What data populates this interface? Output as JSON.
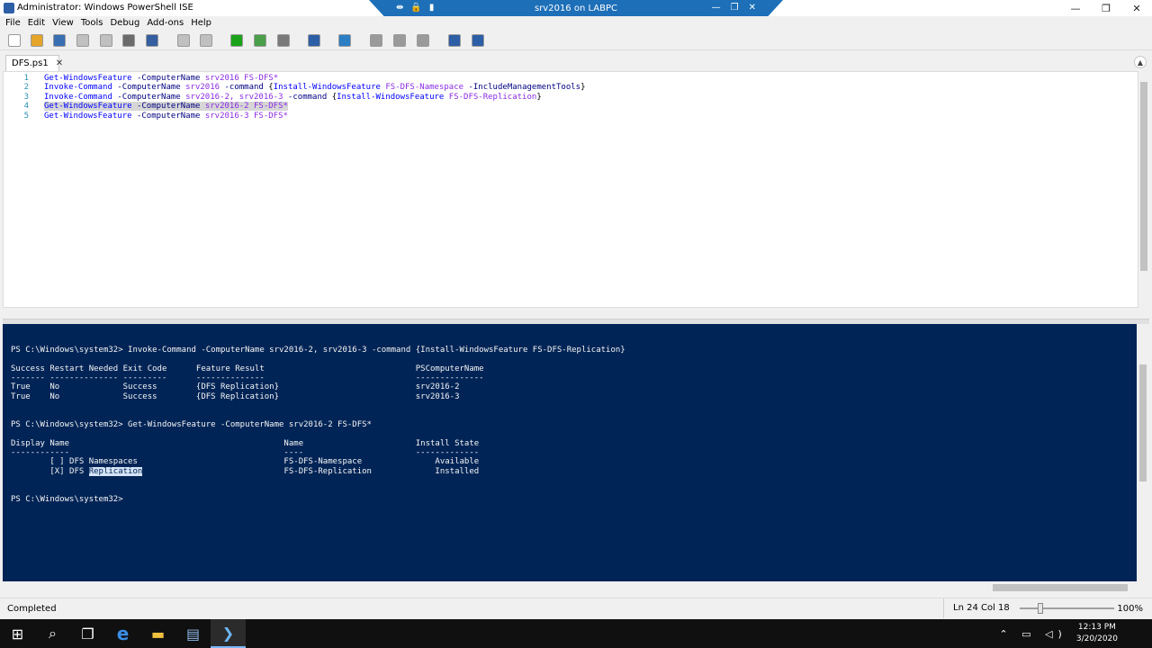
{
  "window": {
    "title": "Administrator: Windows PowerShell ISE",
    "controls": {
      "minimize": "—",
      "restore": "❐",
      "close": "✕"
    }
  },
  "remote_bar": {
    "title": "srv2016 on LABPC",
    "left_icons": [
      "⇹",
      "🔒",
      "▮"
    ],
    "controls": {
      "minimize": "—",
      "restore": "❐",
      "close": "✕"
    }
  },
  "menu": [
    "File",
    "Edit",
    "View",
    "Tools",
    "Debug",
    "Add-ons",
    "Help"
  ],
  "toolbar_icons": [
    {
      "name": "new-icon",
      "color": "#ffffff"
    },
    {
      "name": "open-icon",
      "color": "#e6a42b"
    },
    {
      "name": "save-icon",
      "color": "#3a6fb3"
    },
    {
      "name": "cut-icon",
      "color": "#c0c0c0"
    },
    {
      "name": "copy-icon",
      "color": "#c0c0c0"
    },
    {
      "name": "paste-icon",
      "color": "#6b6b6b"
    },
    {
      "name": "clear-console-icon",
      "color": "#355fa0"
    },
    {
      "name": "undo-icon",
      "color": "#c0c0c0"
    },
    {
      "name": "redo-icon",
      "color": "#c0c0c0"
    },
    {
      "name": "run-script-icon",
      "color": "#1aa31a"
    },
    {
      "name": "run-selection-icon",
      "color": "#4aa04a"
    },
    {
      "name": "stop-icon",
      "color": "#7a7a7a"
    },
    {
      "name": "new-remote-tab-icon",
      "color": "#2d5fa6"
    },
    {
      "name": "start-powershell-icon",
      "color": "#2d7fc4"
    },
    {
      "name": "show-script-top-icon",
      "color": "#9a9a9a"
    },
    {
      "name": "show-script-right-icon",
      "color": "#9a9a9a"
    },
    {
      "name": "show-script-maximized-icon",
      "color": "#9a9a9a"
    },
    {
      "name": "show-command-window-icon",
      "color": "#2d5fa6"
    },
    {
      "name": "show-command-addon-icon",
      "color": "#2d5fa6"
    }
  ],
  "tab": {
    "label": "DFS.ps1",
    "close": "✕"
  },
  "editor": {
    "lines": [
      {
        "num": "1",
        "tokens": [
          {
            "t": "Get-WindowsFeature",
            "c": "cmd"
          },
          {
            "t": " -ComputerName",
            "c": "param"
          },
          {
            "t": " srv2016",
            "c": "arg"
          },
          {
            "t": " FS-DFS*",
            "c": "arg"
          }
        ]
      },
      {
        "num": "2",
        "tokens": [
          {
            "t": "Invoke-Command",
            "c": "cmd"
          },
          {
            "t": " -ComputerName",
            "c": "param"
          },
          {
            "t": " srv2016",
            "c": "arg"
          },
          {
            "t": " -command",
            "c": "param"
          },
          {
            "t": " {",
            "c": "op"
          },
          {
            "t": "Install-WindowsFeature",
            "c": "cmd"
          },
          {
            "t": " FS-DFS-Namespace",
            "c": "arg"
          },
          {
            "t": " -IncludeManagementTools",
            "c": "param"
          },
          {
            "t": "}",
            "c": "op"
          }
        ]
      },
      {
        "num": "3",
        "tokens": [
          {
            "t": "Invoke-Command",
            "c": "cmd"
          },
          {
            "t": " -ComputerName",
            "c": "param"
          },
          {
            "t": " srv2016-2,",
            "c": "arg"
          },
          {
            "t": " srv2016-3",
            "c": "arg"
          },
          {
            "t": " -command",
            "c": "param"
          },
          {
            "t": " {",
            "c": "op"
          },
          {
            "t": "Install-WindowsFeature",
            "c": "cmd"
          },
          {
            "t": " FS-DFS-Replication",
            "c": "arg"
          },
          {
            "t": "}",
            "c": "op"
          }
        ]
      },
      {
        "num": "4",
        "highlighted": true,
        "tokens": [
          {
            "t": "Get-WindowsFeature",
            "c": "cmd"
          },
          {
            "t": " -ComputerName",
            "c": "param"
          },
          {
            "t": " srv2016-2",
            "c": "arg"
          },
          {
            "t": " FS-DFS*",
            "c": "arg"
          }
        ]
      },
      {
        "num": "5",
        "tokens": [
          {
            "t": "Get-WindowsFeature",
            "c": "cmd"
          },
          {
            "t": " -ComputerName",
            "c": "param"
          },
          {
            "t": " srv2016-3",
            "c": "arg"
          },
          {
            "t": " FS-DFS*",
            "c": "arg"
          }
        ]
      }
    ]
  },
  "console": {
    "lines": [
      {
        "text": "PS C:\\Windows\\system32> Invoke-Command -ComputerName srv2016-2, srv2016-3 -command {Install-WindowsFeature FS-DFS-Replication}"
      },
      {
        "text": ""
      },
      {
        "text": "Success Restart Needed Exit Code      Feature Result                               PSComputerName"
      },
      {
        "text": "------- -------------- ---------      --------------                               --------------"
      },
      {
        "text": "True    No             Success        {DFS Replication}                            srv2016-2"
      },
      {
        "text": "True    No             Success        {DFS Replication}                            srv2016-3"
      },
      {
        "text": ""
      },
      {
        "text": ""
      },
      {
        "text": "PS C:\\Windows\\system32> Get-WindowsFeature -ComputerName srv2016-2 FS-DFS*"
      },
      {
        "text": ""
      },
      {
        "text": "Display Name                                            Name                       Install State"
      },
      {
        "text": "------------                                            ----                       -------------"
      },
      {
        "text": "        [ ] DFS Namespaces                              FS-DFS-Namespace               Available"
      },
      {
        "pre": "        [X] DFS ",
        "sel": "Replication",
        "post": "                             FS-DFS-Replication             Installed"
      },
      {
        "text": ""
      },
      {
        "text": ""
      },
      {
        "text": "PS C:\\Windows\\system32>"
      }
    ]
  },
  "status": {
    "text": "Completed",
    "position": "Ln 24  Col 18",
    "zoom": "100%",
    "zoom_level": 0.2
  },
  "taskbar": {
    "items": [
      {
        "name": "start-icon",
        "glyph": "⊞"
      },
      {
        "name": "search-icon",
        "glyph": "⌕"
      },
      {
        "name": "task-view-icon",
        "glyph": "❐"
      },
      {
        "name": "edge-icon",
        "glyph": "e"
      },
      {
        "name": "file-explorer-icon",
        "glyph": "▬"
      },
      {
        "name": "server-manager-icon",
        "glyph": "▤"
      },
      {
        "name": "powershell-ise-icon",
        "glyph": "❯"
      }
    ],
    "tray_icons": "⌃ ▭ ◁)",
    "time": "12:13 PM",
    "date": "3/20/2020"
  }
}
